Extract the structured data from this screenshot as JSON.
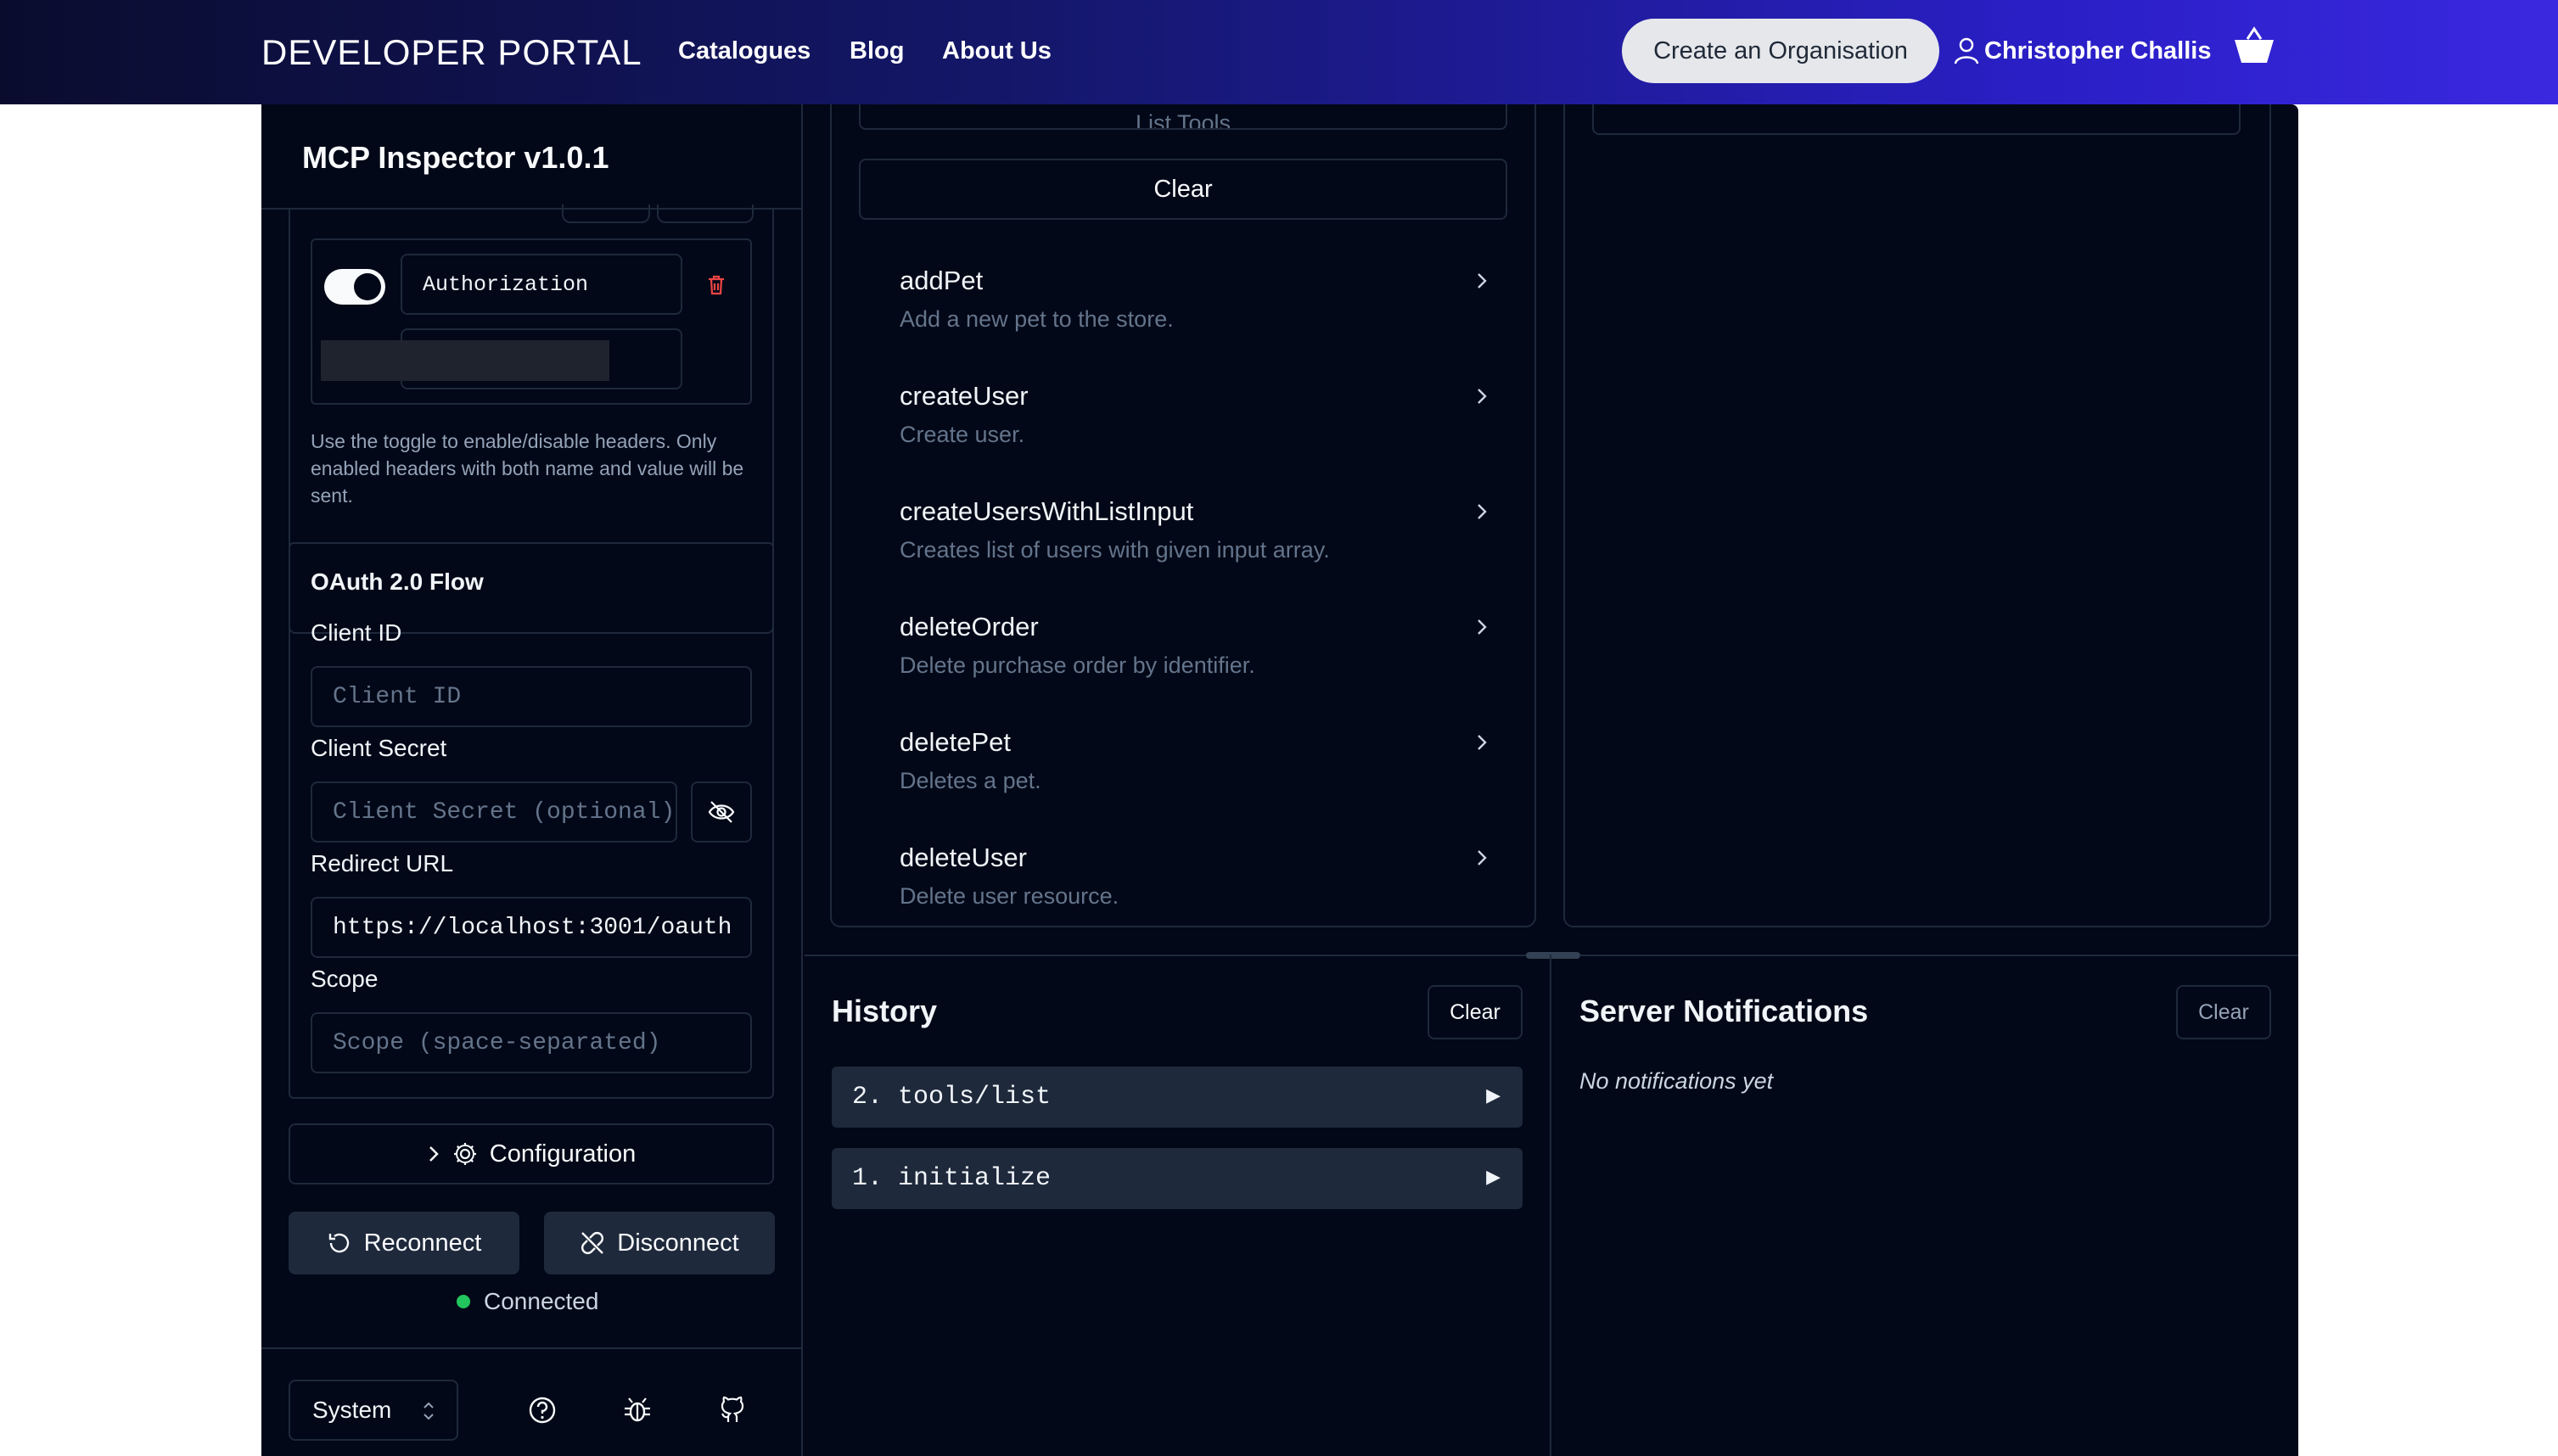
{
  "topnav": {
    "brand": "DEVELOPER PORTAL",
    "links": [
      "Catalogues",
      "Blog",
      "About Us"
    ],
    "org_button": "Create an Organisation",
    "user_name": "Christopher Challis",
    "basket_icon": "basket-icon"
  },
  "sidebar": {
    "title": "MCP Inspector v1.0.1",
    "headers": {
      "enabled": true,
      "name_value": "Authorization",
      "hint": "Use the toggle to enable/disable headers. Only enabled headers with both name and value will be sent."
    },
    "oauth": {
      "title": "OAuth 2.0 Flow",
      "client_id_label": "Client ID",
      "client_id_placeholder": "Client ID",
      "client_secret_label": "Client Secret",
      "client_secret_placeholder": "Client Secret (optional)",
      "redirect_label": "Redirect URL",
      "redirect_value": "https://localhost:3001/oauth",
      "scope_label": "Scope",
      "scope_placeholder": "Scope (space-separated)"
    },
    "configuration_label": "Configuration",
    "reconnect_label": "Reconnect",
    "disconnect_label": "Disconnect",
    "status": "Connected",
    "theme_select": "System"
  },
  "tools": {
    "list_button_partial": "List Tools",
    "clear_label": "Clear",
    "items": [
      {
        "name": "addPet",
        "desc": "Add a new pet to the store."
      },
      {
        "name": "createUser",
        "desc": "Create user."
      },
      {
        "name": "createUsersWithListInput",
        "desc": "Creates list of users with given input array."
      },
      {
        "name": "deleteOrder",
        "desc": "Delete purchase order by identifier."
      },
      {
        "name": "deletePet",
        "desc": "Deletes a pet."
      },
      {
        "name": "deleteUser",
        "desc": "Delete user resource."
      }
    ]
  },
  "history": {
    "title": "History",
    "clear_label": "Clear",
    "items": [
      "2.  tools/list",
      "1.  initialize"
    ]
  },
  "notifications": {
    "title": "Server Notifications",
    "clear_label": "Clear",
    "empty": "No notifications yet"
  },
  "colors": {
    "background": "#020817",
    "border": "#1e293b",
    "status_green": "#22c55e",
    "delete_red": "#ef4444"
  }
}
